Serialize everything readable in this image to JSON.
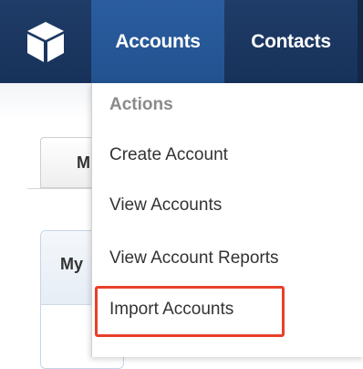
{
  "nav": {
    "logo_icon": "cube-logo-icon",
    "tabs": [
      {
        "label": "Accounts",
        "active": true
      },
      {
        "label": "Contacts",
        "active": false
      }
    ]
  },
  "background": {
    "sub_tab_label": "M",
    "panel_title": "My"
  },
  "dropdown": {
    "heading": "Actions",
    "items": [
      {
        "label": "Create Account"
      },
      {
        "label": "View Accounts"
      },
      {
        "label": "View Account Reports"
      },
      {
        "label": "Import Accounts",
        "highlighted": true
      }
    ],
    "highlight_color": "#e8402a"
  },
  "colors": {
    "nav_bg": "#1f3c68",
    "active_tab_bg": "#2a5da0"
  }
}
